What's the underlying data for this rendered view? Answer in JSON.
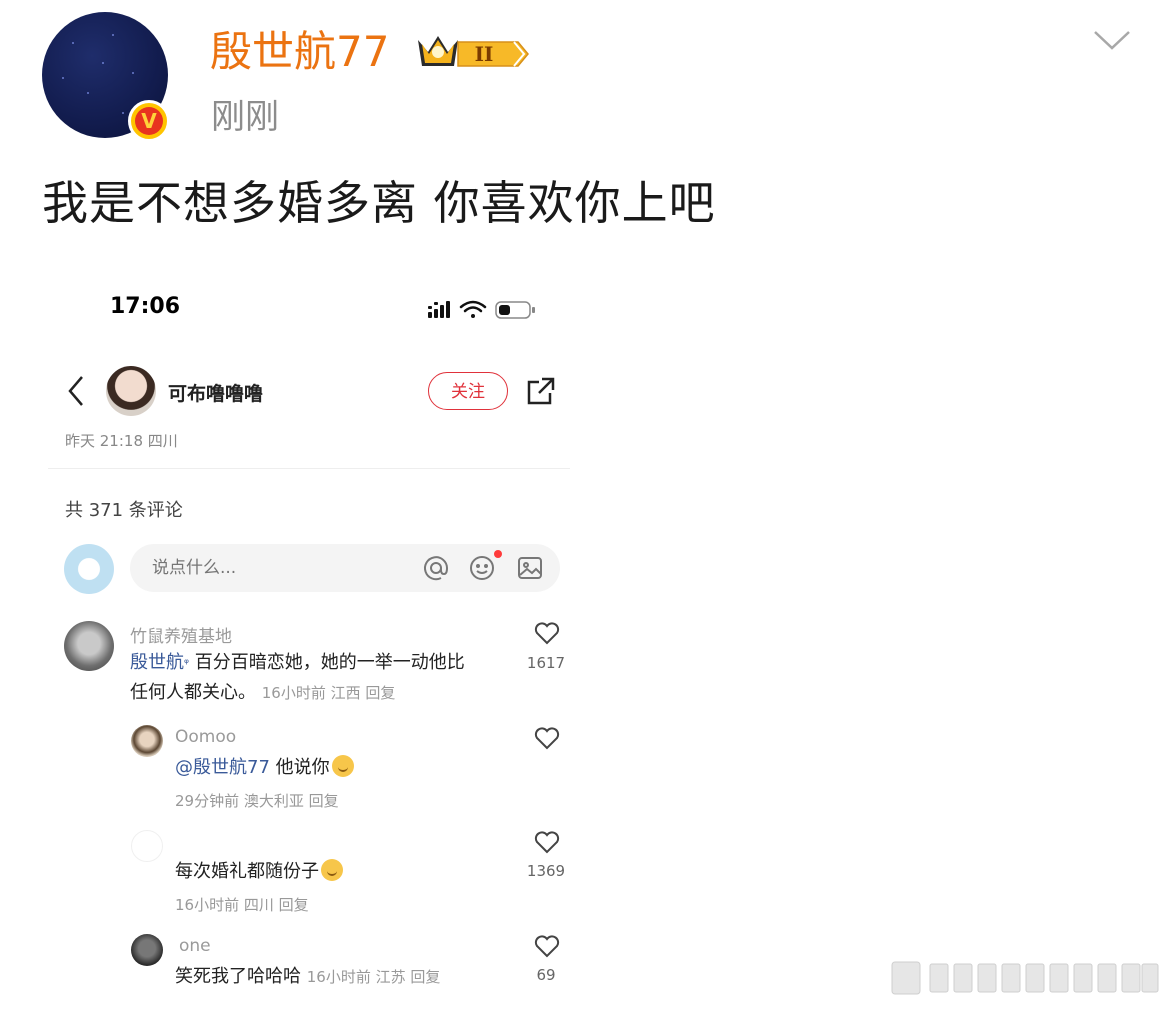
{
  "post": {
    "username": "殷世航77",
    "level_badge": "II",
    "time": "刚刚",
    "text": "我是不想多婚多离 你喜欢你上吧",
    "verified_mark": "V"
  },
  "embedded": {
    "status_bar": {
      "time": "17:06"
    },
    "author": {
      "name": "可布噜噜噜",
      "follow_label": "关注",
      "meta": "昨天 21:18 四川"
    },
    "comments_total": "共 371 条评论",
    "input": {
      "placeholder": "说点什么..."
    },
    "comments": [
      {
        "name": "竹鼠养殖基地",
        "mention": "殷世航",
        "mention_suffix": "ᵠ",
        "text_line1": " 百分百暗恋她，她的一举一动他比",
        "text_line2": "任何人都关心。",
        "meta": "16小时前 江西 回复",
        "likes": "1617"
      },
      {
        "name": "Oomoo",
        "mention": "@殷世航77",
        "text": " 他说你",
        "meta": "29分钟前 澳大利亚 回复",
        "likes": ""
      },
      {
        "name": "",
        "text": "每次婚礼都随份子",
        "meta": "16小时前 四川 回复",
        "likes": "1369"
      },
      {
        "name": "one",
        "text": "笑死我了哈哈哈",
        "meta": "16小时前 江苏 回复",
        "likes": "69"
      }
    ]
  },
  "colors": {
    "username": "#eb7311",
    "follow": "#e0323b",
    "mention": "#3a5a99"
  }
}
